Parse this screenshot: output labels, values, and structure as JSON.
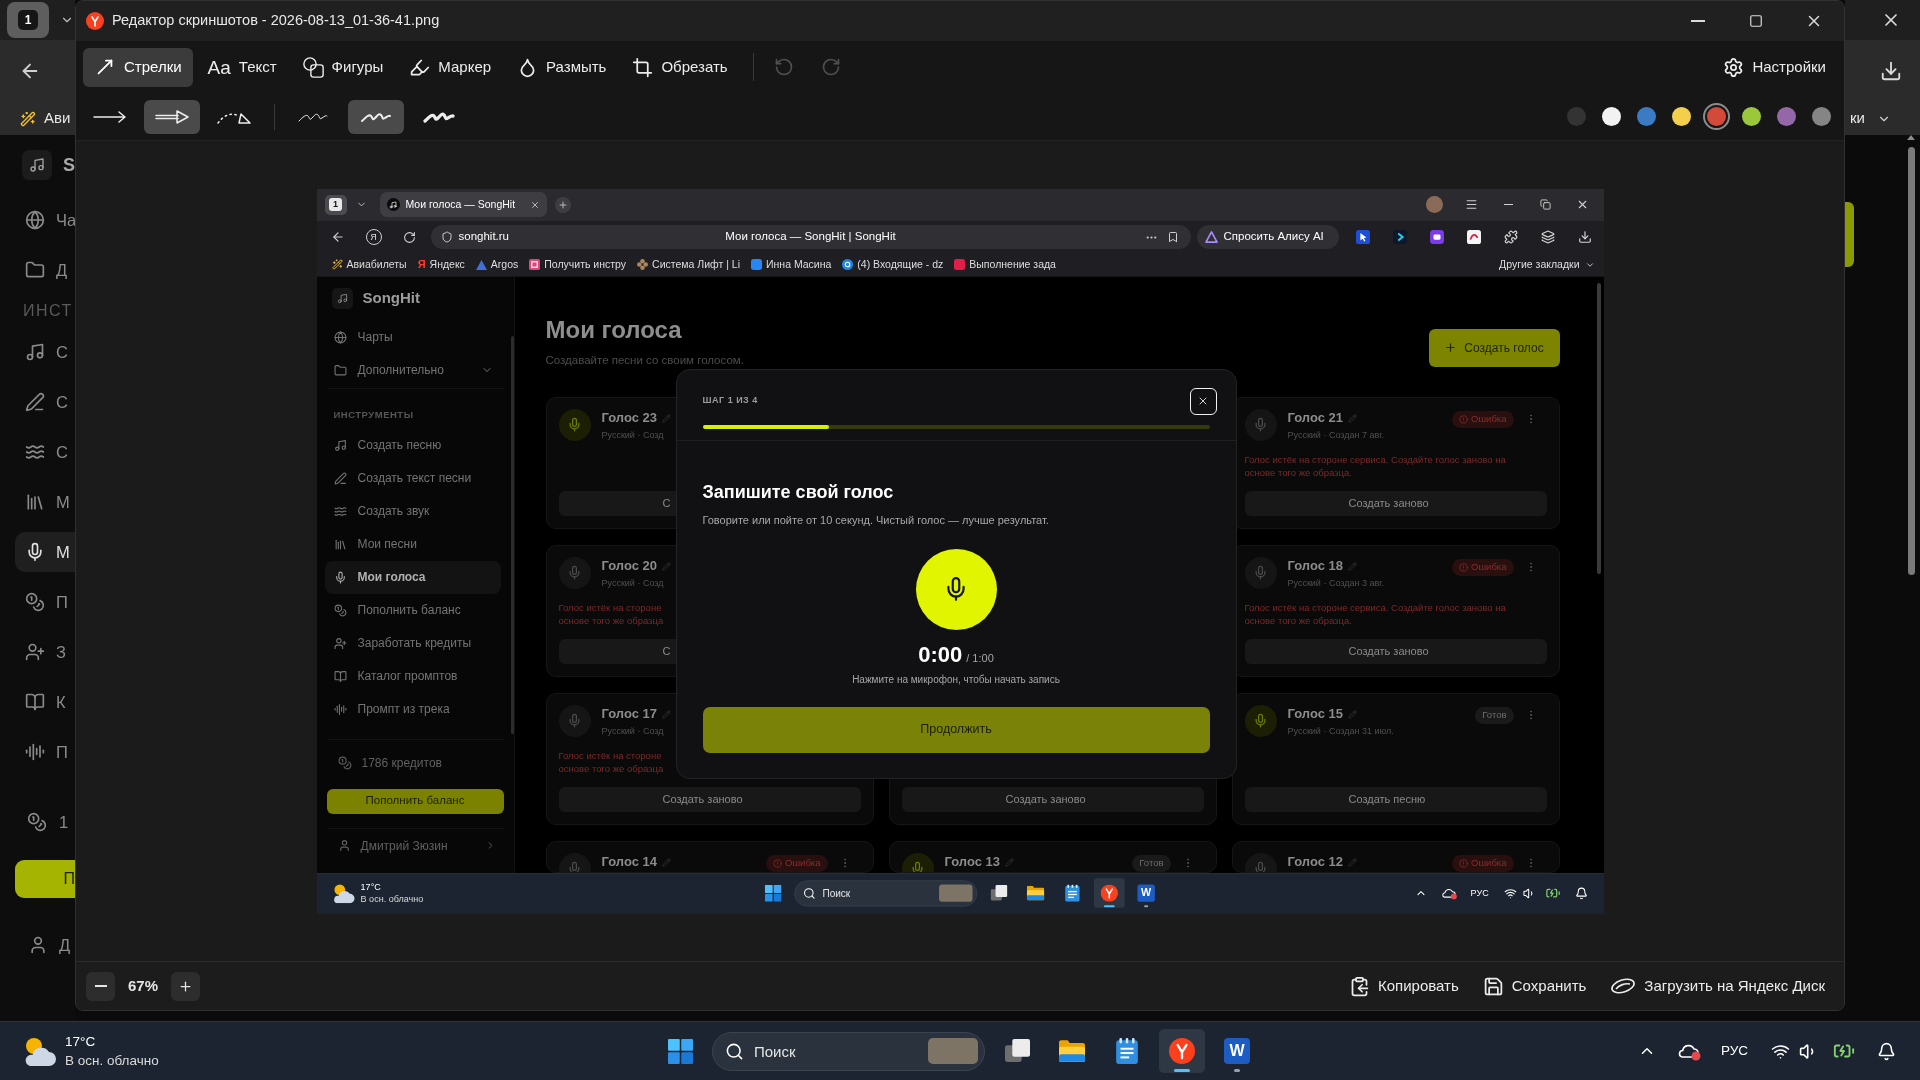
{
  "outer_browser": {
    "tab_count": "1",
    "bookmark_fragment": "Ави",
    "bookmarks_fragment": "ки",
    "sidebar": {
      "brand": "S",
      "charts": "Ча",
      "more": "Д",
      "section": "ИНСТ",
      "items": [
        {
          "kind": "song",
          "text": "С",
          "selected": false
        },
        {
          "kind": "lyrics",
          "text": "С",
          "selected": false
        },
        {
          "kind": "sound",
          "text": "С",
          "selected": false
        },
        {
          "kind": "songs",
          "text": "М",
          "selected": false
        },
        {
          "kind": "voices",
          "text": "М",
          "selected": true
        },
        {
          "kind": "balance",
          "text": "П",
          "selected": false
        },
        {
          "kind": "earn",
          "text": "З",
          "selected": false
        },
        {
          "kind": "catalog",
          "text": "К",
          "selected": false
        },
        {
          "kind": "prompt",
          "text": "П",
          "selected": false
        }
      ],
      "credits": "1",
      "topup": "П",
      "user": "Д"
    }
  },
  "editor": {
    "title": "Редактор скриншотов - 2026-08-13_01-36-41.png",
    "tools": [
      {
        "kind": "arrows",
        "label": "Стрелки",
        "selected": true
      },
      {
        "kind": "text",
        "glyph": "Aa",
        "label": "Текст",
        "selected": false
      },
      {
        "kind": "shapes",
        "label": "Фигуры",
        "selected": false
      },
      {
        "kind": "marker",
        "label": "Маркер",
        "selected": false
      },
      {
        "kind": "blur",
        "label": "Размыть",
        "selected": false
      },
      {
        "kind": "crop",
        "label": "Обрезать",
        "selected": false
      }
    ],
    "history": [
      {
        "kind": "undo",
        "disabled": true
      },
      {
        "kind": "redo",
        "disabled": true
      }
    ],
    "settings": "Настройки",
    "arrow_styles": [
      {
        "kind": "line",
        "selected": false
      },
      {
        "kind": "outline",
        "selected": true
      },
      {
        "kind": "dotted",
        "selected": false
      }
    ],
    "stroke_widths": [
      {
        "kind": "thin",
        "selected": false
      },
      {
        "kind": "medium",
        "selected": true
      },
      {
        "kind": "thick",
        "selected": false
      }
    ],
    "colors": [
      {
        "color": "#333333",
        "selected": false
      },
      {
        "color": "#f2f2f2",
        "selected": false
      },
      {
        "color": "#3b7bc4",
        "selected": false
      },
      {
        "color": "#f4cf4c",
        "selected": false
      },
      {
        "color": "#d44a3a",
        "selected": true
      },
      {
        "color": "#9bc83a",
        "selected": false
      },
      {
        "color": "#9467a8",
        "selected": false
      },
      {
        "color": "#858585",
        "selected": false
      }
    ],
    "zoom": "67%",
    "actions": [
      {
        "kind": "copy",
        "label": "Копировать"
      },
      {
        "kind": "save",
        "label": "Сохранить"
      },
      {
        "kind": "upload",
        "label": "Загрузить на Яндекс Диск"
      }
    ]
  },
  "screenshot": {
    "browser": {
      "tab_count": "1",
      "tab_title": "Мои голоса — SongHit",
      "home_glyph": "Я",
      "url": "songhit.ru",
      "page_title": "Мои голоса — SongHit | SongHit",
      "assistant": "Спросить Алису AI",
      "extensions": [
        {
          "kind": "cursor"
        },
        {
          "kind": "play"
        },
        {
          "kind": "screen"
        },
        {
          "kind": "tile"
        },
        {
          "kind": "puzzle"
        },
        {
          "kind": "layers"
        },
        {
          "kind": "download"
        }
      ],
      "bookmarks": [
        {
          "kind": "wand",
          "label": "Авиабилеты"
        },
        {
          "kind": "letter",
          "glyph": "Я",
          "label": "Яндекс"
        },
        {
          "kind": "triangle",
          "label": "Argos"
        },
        {
          "kind": "frame",
          "label": "Получить инстру"
        },
        {
          "kind": "flower",
          "label": "Система Лифт | Li"
        },
        {
          "kind": "square",
          "label": "Инна Масина"
        },
        {
          "kind": "circle",
          "label": "(4) Входящие - dz"
        },
        {
          "kind": "tile",
          "label": "Выполнение зада"
        }
      ],
      "other_bookmarks": "Другие закладки"
    },
    "sidebar": {
      "brand": "SongHit",
      "charts": "Чарты",
      "more": {
        "label": "Дополнительно",
        "expanded": false
      },
      "section": "ИНСТРУМЕНТЫ",
      "items": [
        {
          "kind": "song",
          "label": "Создать песню",
          "selected": false
        },
        {
          "kind": "lyrics",
          "label": "Создать текст песни",
          "selected": false
        },
        {
          "kind": "sound",
          "label": "Создать звук",
          "selected": false
        },
        {
          "kind": "songs",
          "label": "Мои песни",
          "selected": false
        },
        {
          "kind": "voices",
          "label": "Мои голоса",
          "selected": true
        },
        {
          "kind": "balance",
          "label": "Пополнить баланс",
          "selected": false
        },
        {
          "kind": "earn",
          "label": "Заработать кредиты",
          "selected": false
        },
        {
          "kind": "catalog",
          "label": "Каталог промптов",
          "selected": false
        },
        {
          "kind": "prompt",
          "label": "Промпт из трека",
          "selected": false
        }
      ],
      "credits": "1786 кредитов",
      "topup": "Пополнить баланс",
      "user": "Дмитрий Зюзин"
    },
    "main": {
      "title": "Мои голоса",
      "subtitle": "Создавайте песни со своим голосом.",
      "create_button": "Создать голос",
      "card_rows": [
        [
          {
            "kind": "ready",
            "title": "Голос 23",
            "meta": "Русский · Созд",
            "button": "С"
          },
          null,
          {
            "kind": "error",
            "title": "Голос 21",
            "meta": "Русский · Создан 7 авг.",
            "status": {
              "kind": "error",
              "label": "Ошибка"
            },
            "error_lines": [
              "Голос истёк на стороне сервиса. Создайте голос заново на",
              "основе того же образца."
            ],
            "button": "Создать заново"
          }
        ],
        [
          {
            "kind": "error",
            "title": "Голос 20",
            "meta": "Русский · Созд",
            "error_lines": [
              "Голос истёк на стороне",
              "основе того же образца"
            ],
            "button": "С"
          },
          null,
          {
            "kind": "error",
            "title": "Голос 18",
            "meta": "Русский · Создан 3 авг.",
            "status": {
              "kind": "error",
              "label": "Ошибка"
            },
            "error_lines": [
              "Голос истёк на стороне сервиса. Создайте голос заново на",
              "основе того же образца."
            ],
            "button": "Создать заново"
          }
        ],
        [
          {
            "kind": "error",
            "title": "Голос 17",
            "meta": "Русский · Созд",
            "error_lines": [
              "Голос истёк на стороне",
              "основе того же образца"
            ],
            "button": "Создать заново"
          },
          {
            "button": "Создать заново"
          },
          {
            "kind": "ready",
            "title": "Голос 15",
            "meta": "Русский · Создан 31 июл.",
            "status": {
              "kind": "ready",
              "label": "Готов"
            },
            "button": "Создать песню"
          }
        ],
        [
          {
            "kind": "error",
            "title": "Голос 14",
            "status": {
              "kind": "error",
              "label": "Ошибка"
            }
          },
          {
            "kind": "ready",
            "title": "Голос 13",
            "status": {
              "kind": "ready",
              "label": "Готов"
            }
          },
          {
            "kind": "error",
            "title": "Голос 12",
            "status": {
              "kind": "error",
              "label": "Ошибка"
            }
          }
        ]
      ]
    },
    "modal": {
      "step": "ШАГ 1 ИЗ 4",
      "progress": {
        "level": 0.25
      },
      "title": "Запишите свой голос",
      "description": "Говорите или пойте от 10 секунд. Чистый голос — лучше результат.",
      "timer": "0:00",
      "duration": "/ 1:00",
      "hint": "Нажмите на микрофон, чтобы начать запись",
      "button": "Продолжить"
    },
    "taskbar": {
      "temperature": "17°C",
      "weather": "В осн. облачно",
      "search_placeholder": "Поиск",
      "apps": [
        {
          "kind": "start",
          "selected": false,
          "running": false
        },
        {
          "kind": "task-view",
          "selected": false,
          "running": false
        },
        {
          "kind": "explorer",
          "selected": false,
          "running": false
        },
        {
          "kind": "notepad",
          "selected": false,
          "running": false
        },
        {
          "kind": "browser",
          "selected": true,
          "running": true
        },
        {
          "kind": "word",
          "glyph": "W",
          "selected": false,
          "running": true
        }
      ],
      "language": "РУС"
    }
  },
  "taskbar": {
    "temperature": "17°C",
    "weather": "В осн. облачно",
    "search_placeholder": "Поиск",
    "apps": [
      {
        "kind": "start",
        "selected": false,
        "running": false
      },
      {
        "kind": "task-view",
        "selected": false,
        "running": false
      },
      {
        "kind": "explorer",
        "selected": false,
        "running": false
      },
      {
        "kind": "notepad",
        "selected": false,
        "running": false
      },
      {
        "kind": "browser",
        "selected": true,
        "running": true
      },
      {
        "kind": "word",
        "glyph": "W",
        "selected": false,
        "running": true
      }
    ],
    "language": "РУС"
  }
}
